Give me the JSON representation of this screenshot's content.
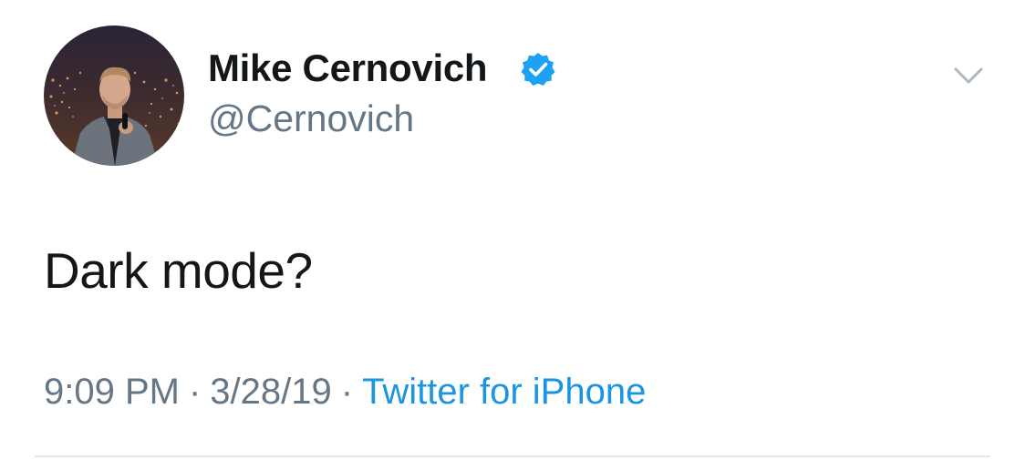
{
  "tweet": {
    "author": {
      "display_name": "Mike Cernovich",
      "handle": "@Cernovich",
      "verified": true,
      "verified_icon": "verified-badge-icon",
      "avatar": "profile-photo"
    },
    "text": "Dark mode?",
    "time": "9:09 PM",
    "date": "3/28/19",
    "separator": "·",
    "source": "Twitter for iPhone",
    "menu_icon": "chevron-down-icon"
  },
  "colors": {
    "name": "#14171a",
    "secondary": "#657786",
    "link": "#1b95e0",
    "verified": "#1da1f2",
    "divider": "#e1e8ed"
  }
}
